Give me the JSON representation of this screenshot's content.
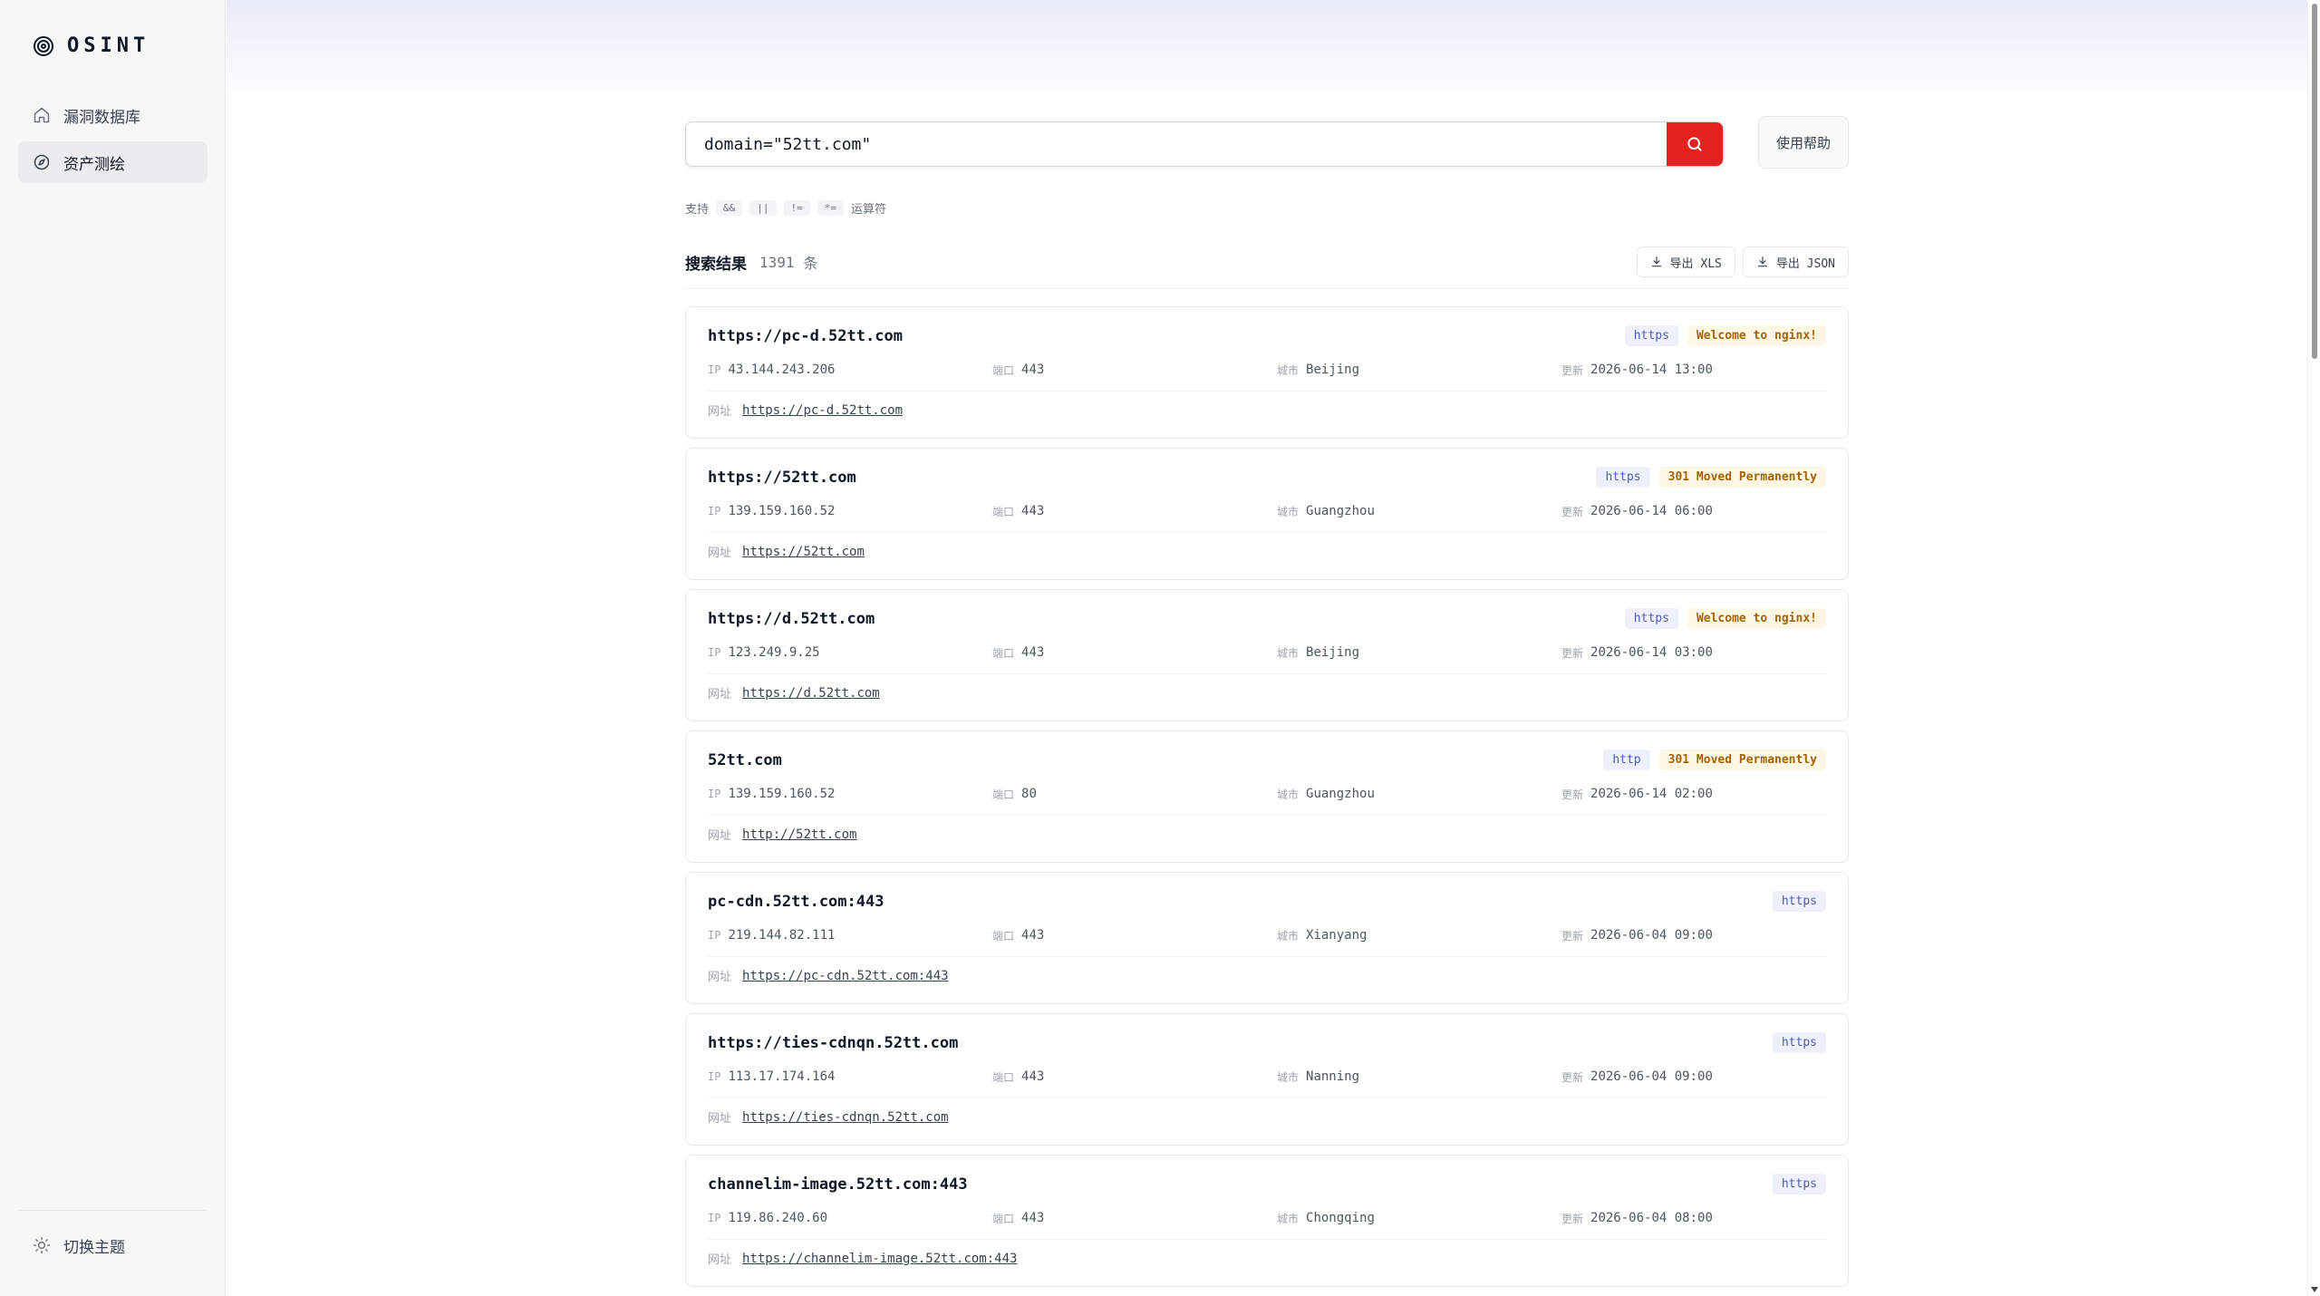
{
  "app": {
    "brand": "OSINT",
    "nav": [
      {
        "label": "漏洞数据库",
        "icon": "home-icon",
        "active": false
      },
      {
        "label": "资产测绘",
        "icon": "compass-icon",
        "active": true
      }
    ],
    "theme_toggle": "切换主题"
  },
  "search": {
    "query": "domain=\"52tt.com\"",
    "help_label": "使用帮助"
  },
  "operators": {
    "prefix": "支持",
    "items": [
      "&&",
      "||",
      "!=",
      "*="
    ],
    "suffix": "运算符"
  },
  "results": {
    "title": "搜索结果",
    "count": "1391",
    "unit": "条",
    "export_xls": "导出 XLS",
    "export_json": "导出 JSON",
    "labels": {
      "ip": "IP",
      "port": "端口",
      "city": "城市",
      "updated": "更新",
      "url": "网址"
    },
    "items": [
      {
        "title": "https://pc-d.52tt.com",
        "protocol": "https",
        "status": "Welcome to nginx!",
        "ip": "43.144.243.206",
        "port": "443",
        "city": "Beijing",
        "updated": "2026-06-14 13:00",
        "url": "https://pc-d.52tt.com"
      },
      {
        "title": "https://52tt.com",
        "protocol": "https",
        "status": "301 Moved Permanently",
        "ip": "139.159.160.52",
        "port": "443",
        "city": "Guangzhou",
        "updated": "2026-06-14 06:00",
        "url": "https://52tt.com"
      },
      {
        "title": "https://d.52tt.com",
        "protocol": "https",
        "status": "Welcome to nginx!",
        "ip": "123.249.9.25",
        "port": "443",
        "city": "Beijing",
        "updated": "2026-06-14 03:00",
        "url": "https://d.52tt.com"
      },
      {
        "title": "52tt.com",
        "protocol": "http",
        "status": "301 Moved Permanently",
        "ip": "139.159.160.52",
        "port": "80",
        "city": "Guangzhou",
        "updated": "2026-06-14 02:00",
        "url": "http://52tt.com"
      },
      {
        "title": "pc-cdn.52tt.com:443",
        "protocol": "https",
        "status": "",
        "ip": "219.144.82.111",
        "port": "443",
        "city": "Xianyang",
        "updated": "2026-06-04 09:00",
        "url": "https://pc-cdn.52tt.com:443"
      },
      {
        "title": "https://ties-cdnqn.52tt.com",
        "protocol": "https",
        "status": "",
        "ip": "113.17.174.164",
        "port": "443",
        "city": "Nanning",
        "updated": "2026-06-04 09:00",
        "url": "https://ties-cdnqn.52tt.com"
      },
      {
        "title": "channelim-image.52tt.com:443",
        "protocol": "https",
        "status": "",
        "ip": "119.86.240.60",
        "port": "443",
        "city": "Chongqing",
        "updated": "2026-06-04 08:00",
        "url": "https://channelim-image.52tt.com:443"
      }
    ]
  }
}
